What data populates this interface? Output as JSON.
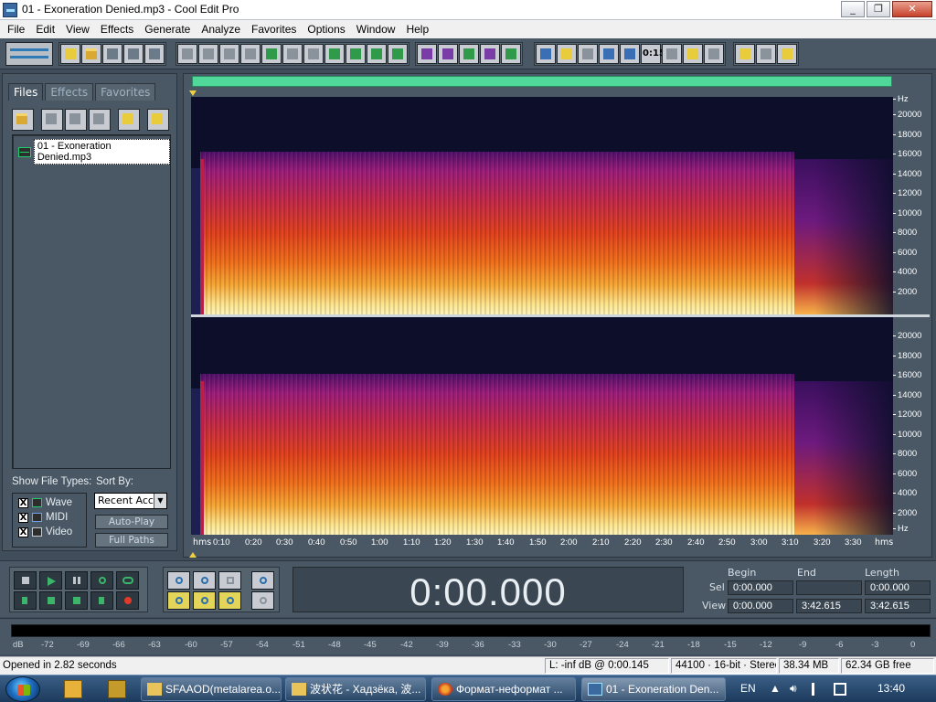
{
  "window": {
    "title": "01 - Exoneration Denied.mp3 - Cool Edit Pro",
    "buttons": [
      "_",
      "❐",
      "✕"
    ]
  },
  "menu": [
    "File",
    "Edit",
    "View",
    "Effects",
    "Generate",
    "Analyze",
    "Favorites",
    "Options",
    "Window",
    "Help"
  ],
  "organizer": {
    "tabs": [
      "Files",
      "Effects",
      "Favorites"
    ],
    "files": [
      "01 - Exoneration Denied.mp3"
    ],
    "show_file_types_label": "Show File Types:",
    "file_types": [
      {
        "label": "Wave",
        "checked": "X"
      },
      {
        "label": "MIDI",
        "checked": "X"
      },
      {
        "label": "Video",
        "checked": "X"
      }
    ],
    "sort_by_label": "Sort By:",
    "sort_by_value": "Recent Acc",
    "auto_play": "Auto-Play",
    "full_paths": "Full Paths"
  },
  "toolbar": {
    "zoom_time_label": "0:15"
  },
  "spectral": {
    "freq_unit": "Hz",
    "freq_ticks": [
      "20000",
      "18000",
      "16000",
      "14000",
      "12000",
      "10000",
      "8000",
      "6000",
      "4000",
      "2000"
    ],
    "time_unit": "hms",
    "time_ticks": [
      "0:10",
      "0:20",
      "0:30",
      "0:40",
      "0:50",
      "1:00",
      "1:10",
      "1:20",
      "1:30",
      "1:40",
      "1:50",
      "2:00",
      "2:10",
      "2:20",
      "2:30",
      "2:40",
      "2:50",
      "3:00",
      "3:10",
      "3:20",
      "3:30"
    ]
  },
  "transport": {
    "time": "0:00.000",
    "headers": {
      "begin": "Begin",
      "end": "End",
      "length": "Length"
    },
    "sel": {
      "label": "Sel",
      "begin": "0:00.000",
      "end": "",
      "length": "0:00.000"
    },
    "view": {
      "label": "View",
      "begin": "0:00.000",
      "end": "3:42.615",
      "length": "3:42.615"
    }
  },
  "meter": {
    "ticks": [
      "dB",
      "-72",
      "-69",
      "-66",
      "-63",
      "-60",
      "-57",
      "-54",
      "-51",
      "-48",
      "-45",
      "-42",
      "-39",
      "-36",
      "-33",
      "-30",
      "-27",
      "-24",
      "-21",
      "-18",
      "-15",
      "-12",
      "-9",
      "-6",
      "-3",
      "0"
    ]
  },
  "status": {
    "message": "Opened in 2.82 seconds",
    "level": "L: -inf dB @   0:00.145",
    "format": "44100 · 16-bit · Stereo",
    "size": "38.34 MB",
    "free": "62.34 GB free"
  },
  "taskbar": {
    "tasks": [
      {
        "label": "SFAAOD(metalarea.o...",
        "active": false
      },
      {
        "label": "波状花 - Хадзёка, 波...",
        "active": false
      },
      {
        "label": "Формат-неформат ...",
        "active": false
      },
      {
        "label": "01 - Exoneration Den...",
        "active": true
      }
    ],
    "lang": "EN",
    "clock": "13:40"
  },
  "colors": {
    "panel_bg": "#4a5865",
    "spectrum_bg": "#0c0e2a",
    "overview_bar": "#4fd89a",
    "cursor_marker": "#f0d040"
  }
}
